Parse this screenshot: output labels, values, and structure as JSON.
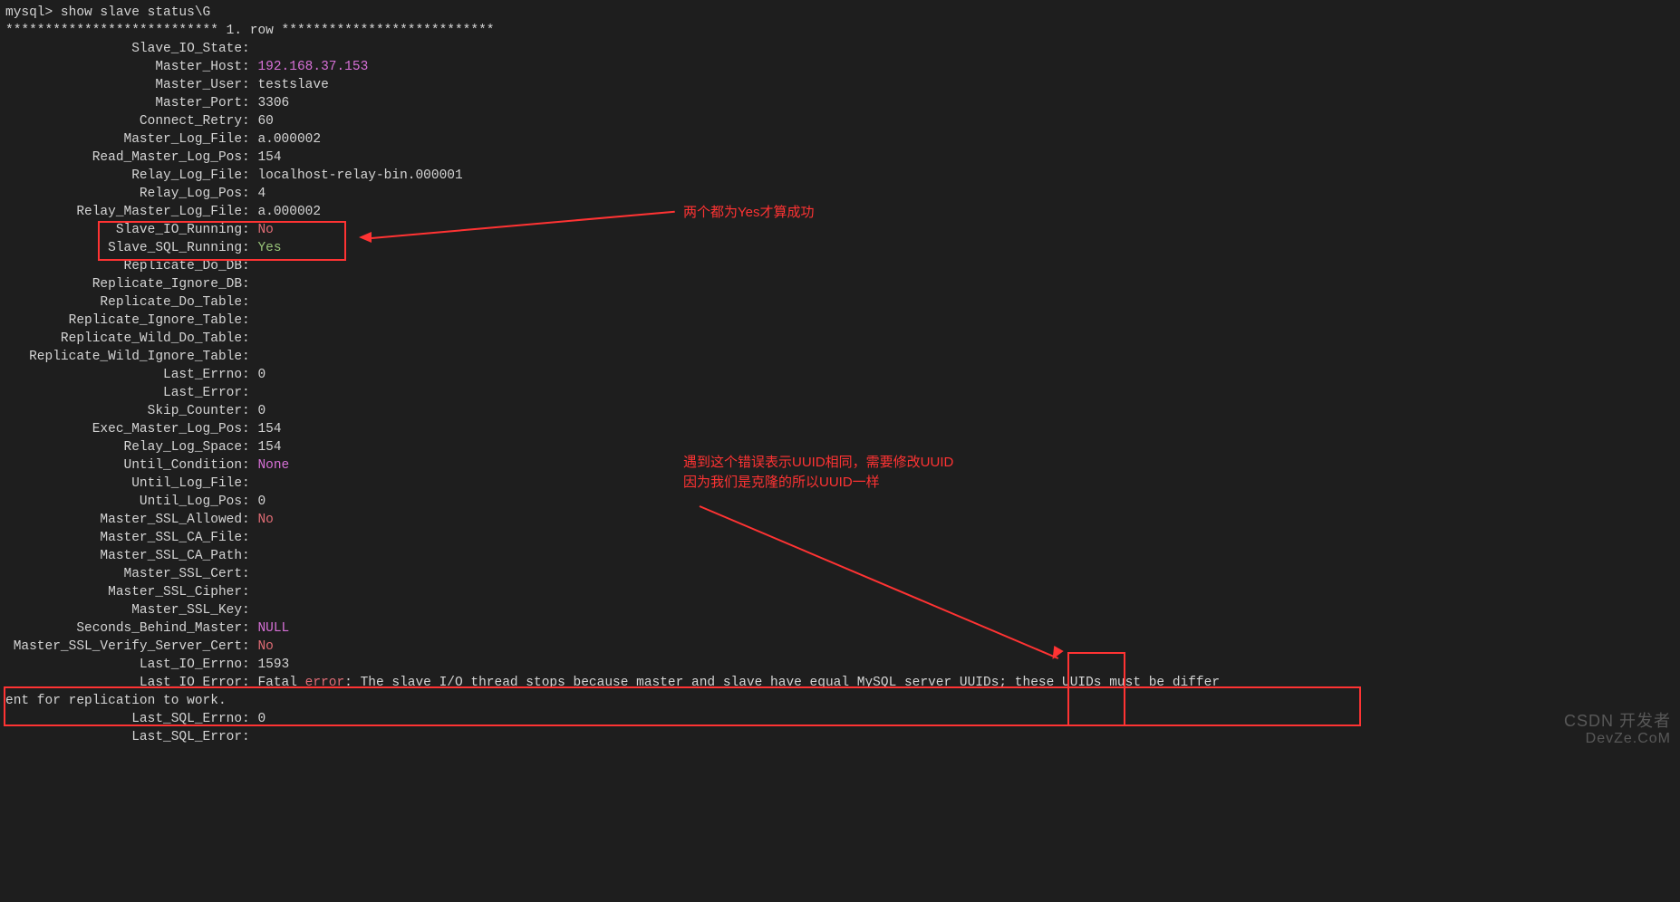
{
  "prompt": "mysql> show slave status\\G",
  "row_header": "*************************** 1. row ***************************",
  "fields": [
    {
      "label": "Slave_IO_State",
      "value": ""
    },
    {
      "label": "Master_Host",
      "value": "192.168.37.153",
      "cls": "pink"
    },
    {
      "label": "Master_User",
      "value": "testslave"
    },
    {
      "label": "Master_Port",
      "value": "3306"
    },
    {
      "label": "Connect_Retry",
      "value": "60"
    },
    {
      "label": "Master_Log_File",
      "value": "a.000002"
    },
    {
      "label": "Read_Master_Log_Pos",
      "value": "154"
    },
    {
      "label": "Relay_Log_File",
      "value": "localhost-relay-bin.000001"
    },
    {
      "label": "Relay_Log_Pos",
      "value": "4"
    },
    {
      "label": "Relay_Master_Log_File",
      "value": "a.000002"
    },
    {
      "label": "Slave_IO_Running",
      "value": "No",
      "cls": "red"
    },
    {
      "label": "Slave_SQL_Running",
      "value": "Yes",
      "cls": "green"
    },
    {
      "label": "Replicate_Do_DB",
      "value": ""
    },
    {
      "label": "Replicate_Ignore_DB",
      "value": ""
    },
    {
      "label": "Replicate_Do_Table",
      "value": ""
    },
    {
      "label": "Replicate_Ignore_Table",
      "value": ""
    },
    {
      "label": "Replicate_Wild_Do_Table",
      "value": ""
    },
    {
      "label": "Replicate_Wild_Ignore_Table",
      "value": ""
    },
    {
      "label": "Last_Errno",
      "value": "0"
    },
    {
      "label": "Last_Error",
      "value": ""
    },
    {
      "label": "Skip_Counter",
      "value": "0"
    },
    {
      "label": "Exec_Master_Log_Pos",
      "value": "154"
    },
    {
      "label": "Relay_Log_Space",
      "value": "154"
    },
    {
      "label": "Until_Condition",
      "value": "None",
      "cls": "pink"
    },
    {
      "label": "Until_Log_File",
      "value": ""
    },
    {
      "label": "Until_Log_Pos",
      "value": "0"
    },
    {
      "label": "Master_SSL_Allowed",
      "value": "No",
      "cls": "red"
    },
    {
      "label": "Master_SSL_CA_File",
      "value": ""
    },
    {
      "label": "Master_SSL_CA_Path",
      "value": ""
    },
    {
      "label": "Master_SSL_Cert",
      "value": ""
    },
    {
      "label": "Master_SSL_Cipher",
      "value": ""
    },
    {
      "label": "Master_SSL_Key",
      "value": ""
    },
    {
      "label": "Seconds_Behind_Master",
      "value": "NULL",
      "cls": "pink"
    },
    {
      "label": "Master_SSL_Verify_Server_Cert",
      "value": "No",
      "cls": "red"
    },
    {
      "label": "Last_IO_Errno",
      "value": "1593"
    },
    {
      "label": "Last_IO_Error",
      "value": "__ERR__"
    },
    {
      "label": "Last_SQL_Errno",
      "value": "0"
    },
    {
      "label": "Last_SQL_Error",
      "value": ""
    }
  ],
  "error_line": {
    "prefix": "Fatal ",
    "error_word": "error",
    "rest": ": The slave I/O thread stops because master and slave have equal MySQL server UUIDs; these UUIDs must be differ",
    "cont": "ent for replication to work."
  },
  "annotations": {
    "top": "两个都为Yes才算成功",
    "mid1": "遇到这个错误表示UUID相同，需要修改UUID",
    "mid2": "因为我们是克隆的所以UUID一样"
  },
  "watermark": {
    "l1": "CSDN 开发者",
    "l2": "DevZe.CoM"
  },
  "pad_col": 30
}
